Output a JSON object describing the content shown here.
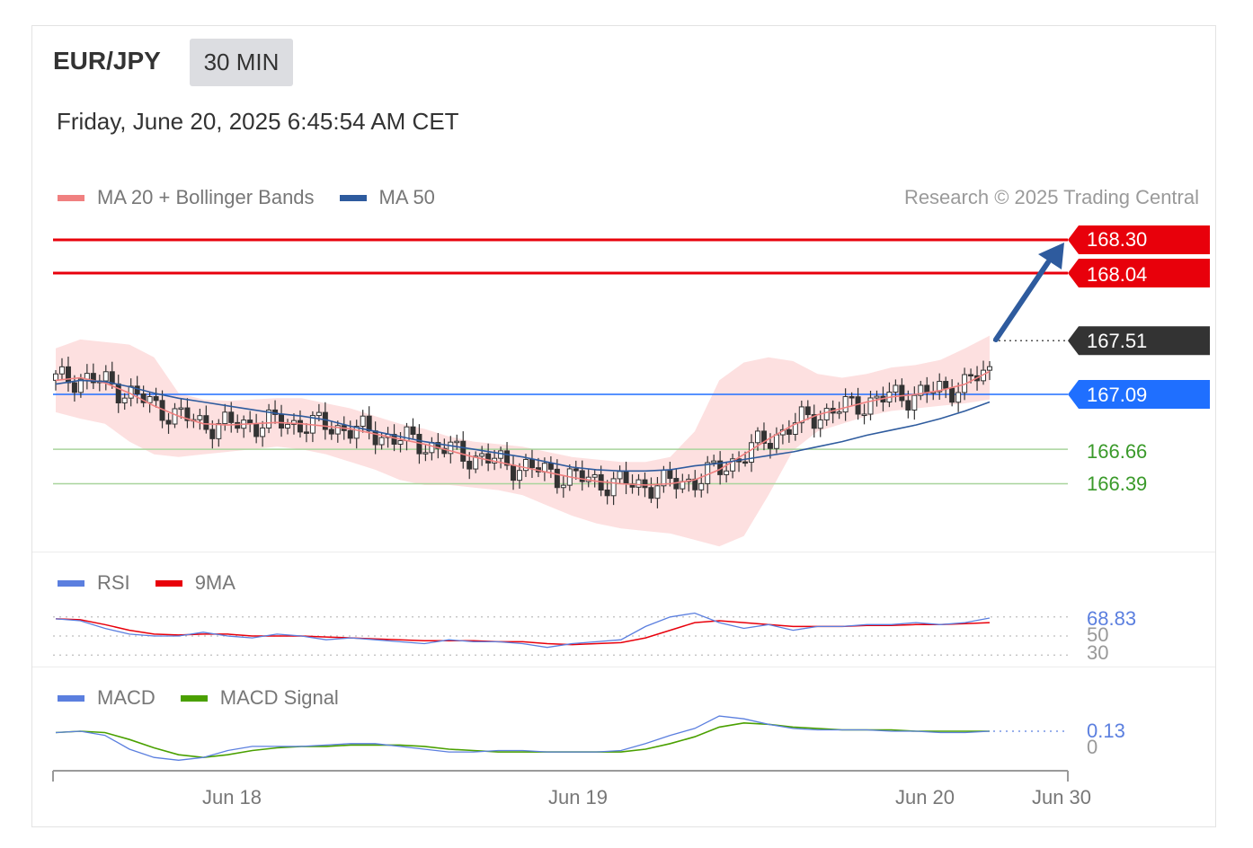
{
  "header": {
    "pair": "EUR/JPY",
    "timeframe": "30 MIN",
    "datetime": "Friday, June 20, 2025 6:45:54 AM CET"
  },
  "legend": {
    "ma20": "MA 20 + Bollinger Bands",
    "ma50": "MA 50",
    "rsi": "RSI",
    "rsi_ma": "9MA",
    "macd": "MACD",
    "macd_signal": "MACD Signal",
    "credit": "Research © 2025 Trading Central"
  },
  "colors": {
    "ma20": "#f08080",
    "bollinger_fill": "#fde0e0",
    "ma50": "#2e5b9e",
    "resistance": "#e8000b",
    "current": "#333333",
    "pivot": "#1f6fff",
    "support": "#3a9a2a",
    "rsi": "#5b7fdf",
    "rsi_ma": "#e8000b",
    "macd": "#5b7fdf",
    "macd_signal": "#4aa000",
    "candle": "#333333",
    "arrow": "#2e5b9e"
  },
  "price_labels": {
    "r2": "168.30",
    "r1": "168.04",
    "current": "167.51",
    "pivot": "167.09",
    "s1": "166.66",
    "s2": "166.39"
  },
  "rsi_labels": {
    "value": "68.83",
    "level_50": "50",
    "level_30": "30"
  },
  "macd_labels": {
    "value": "0.13",
    "zero": "0"
  },
  "x_axis": [
    "Jun 18",
    "Jun 19",
    "Jun 20",
    "Jun 30"
  ],
  "chart_data": [
    {
      "type": "line",
      "title": "",
      "ylim": [
        165.9,
        168.45
      ],
      "x_labels": [
        "Jun 18",
        "Jun 19",
        "Jun 20",
        "Jun 30"
      ],
      "levels": [
        {
          "name": "resistance",
          "value": 168.3
        },
        {
          "name": "resistance",
          "value": 168.04
        },
        {
          "name": "current",
          "value": 167.51
        },
        {
          "name": "pivot",
          "value": 167.09
        },
        {
          "name": "support",
          "value": 166.66
        },
        {
          "name": "support",
          "value": 166.39
        }
      ],
      "series": [
        {
          "name": "MA 20 + Bollinger Bands",
          "values": [
            167.2,
            167.22,
            167.18,
            167.1,
            167.0,
            166.92,
            166.86,
            166.85,
            166.86,
            166.87,
            166.86,
            166.84,
            166.82,
            166.78,
            166.74,
            166.7,
            166.65,
            166.6,
            166.56,
            166.52,
            166.48,
            166.44,
            166.41,
            166.39,
            166.38,
            166.39,
            166.42,
            166.5,
            166.62,
            166.74,
            166.85,
            166.93,
            166.98,
            167.03,
            167.07,
            167.09,
            167.12,
            167.17,
            167.27
          ]
        },
        {
          "name": "MA 50",
          "values": [
            167.17,
            167.2,
            167.19,
            167.15,
            167.1,
            167.06,
            167.03,
            167.0,
            166.97,
            166.94,
            166.92,
            166.89,
            166.84,
            166.8,
            166.76,
            166.72,
            166.69,
            166.66,
            166.63,
            166.6,
            166.56,
            166.52,
            166.5,
            166.49,
            166.49,
            166.5,
            166.53,
            166.55,
            166.58,
            166.61,
            166.64,
            166.68,
            166.72,
            166.77,
            166.81,
            166.85,
            166.9,
            166.96,
            167.03
          ]
        },
        {
          "name": "Bollinger upper",
          "values": [
            167.45,
            167.52,
            167.5,
            167.48,
            167.38,
            167.1,
            167.05,
            167.04,
            167.05,
            167.06,
            167.06,
            167.02,
            166.98,
            166.92,
            166.86,
            166.82,
            166.76,
            166.72,
            166.7,
            166.68,
            166.64,
            166.6,
            166.58,
            166.56,
            166.56,
            166.6,
            166.8,
            167.2,
            167.34,
            167.38,
            167.35,
            167.25,
            167.22,
            167.25,
            167.3,
            167.32,
            167.36,
            167.45,
            167.55
          ]
        },
        {
          "name": "Bollinger lower",
          "values": [
            166.95,
            166.9,
            166.86,
            166.72,
            166.62,
            166.6,
            166.62,
            166.64,
            166.66,
            166.68,
            166.66,
            166.62,
            166.56,
            166.5,
            166.42,
            166.38,
            166.38,
            166.36,
            166.34,
            166.3,
            166.22,
            166.14,
            166.08,
            166.04,
            166.02,
            166.0,
            165.95,
            165.9,
            165.98,
            166.3,
            166.65,
            166.8,
            166.86,
            166.92,
            166.96,
            166.98,
            167.0,
            167.02,
            167.05
          ]
        }
      ]
    },
    {
      "type": "line",
      "title": "",
      "ylim": [
        20,
        90
      ],
      "levels": [
        70,
        50,
        30
      ],
      "series": [
        {
          "name": "RSI",
          "values": [
            68,
            66,
            58,
            52,
            50,
            50,
            54,
            50,
            48,
            52,
            50,
            46,
            48,
            46,
            44,
            42,
            46,
            44,
            44,
            42,
            38,
            42,
            44,
            46,
            60,
            70,
            74,
            64,
            58,
            62,
            56,
            60,
            60,
            62,
            62,
            64,
            62,
            64,
            68.83
          ]
        },
        {
          "name": "9MA",
          "values": [
            68,
            67,
            62,
            56,
            52,
            51,
            52,
            52,
            50,
            50,
            50,
            49,
            48,
            47,
            46,
            45,
            45,
            45,
            44,
            44,
            42,
            41,
            42,
            43,
            48,
            56,
            64,
            66,
            64,
            62,
            60,
            60,
            60,
            61,
            61,
            62,
            62,
            63,
            64
          ]
        }
      ]
    },
    {
      "type": "line",
      "title": "",
      "ylim": [
        -0.22,
        0.28
      ],
      "series": [
        {
          "name": "MACD",
          "values": [
            0.12,
            0.13,
            0.1,
            0.0,
            -0.06,
            -0.08,
            -0.06,
            -0.01,
            0.02,
            0.02,
            0.02,
            0.03,
            0.04,
            0.04,
            0.02,
            0.0,
            -0.02,
            -0.02,
            -0.01,
            -0.01,
            -0.02,
            -0.02,
            -0.02,
            -0.01,
            0.04,
            0.1,
            0.15,
            0.24,
            0.22,
            0.18,
            0.15,
            0.14,
            0.14,
            0.14,
            0.13,
            0.13,
            0.12,
            0.12,
            0.13
          ]
        },
        {
          "name": "MACD Signal",
          "values": [
            0.12,
            0.13,
            0.12,
            0.07,
            0.01,
            -0.04,
            -0.06,
            -0.04,
            -0.01,
            0.01,
            0.02,
            0.02,
            0.03,
            0.03,
            0.03,
            0.02,
            0.0,
            -0.01,
            -0.02,
            -0.02,
            -0.02,
            -0.02,
            -0.02,
            -0.02,
            0.0,
            0.04,
            0.09,
            0.16,
            0.19,
            0.18,
            0.16,
            0.15,
            0.14,
            0.14,
            0.14,
            0.13,
            0.13,
            0.13,
            0.13
          ]
        }
      ]
    }
  ]
}
